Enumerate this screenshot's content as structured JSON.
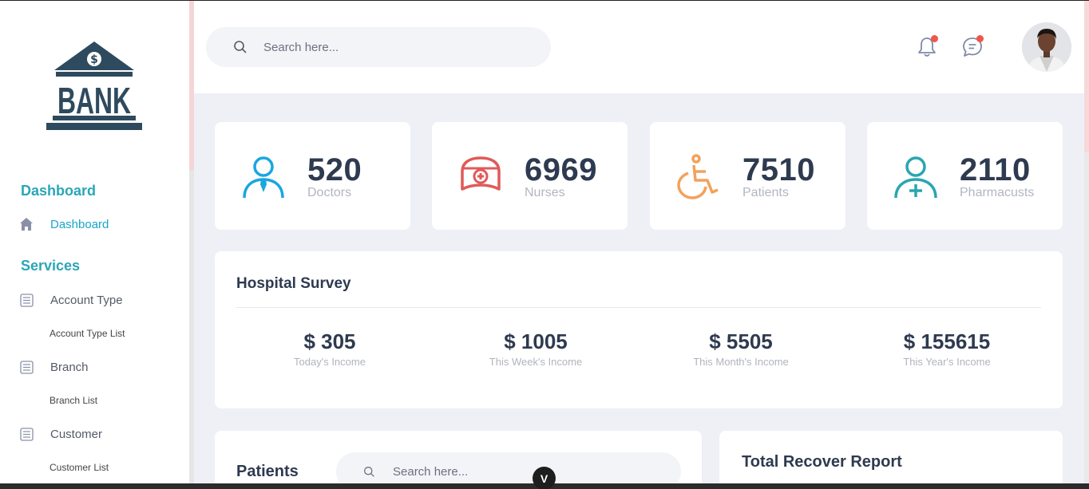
{
  "sidebar": {
    "logo_text": "BANK",
    "sections": [
      {
        "label": "Dashboard"
      },
      {
        "label": "Services"
      }
    ],
    "items": [
      {
        "label": "Dashboard",
        "icon": "home-icon"
      },
      {
        "label": "Account Type",
        "icon": "list-icon",
        "sub": "Account Type List"
      },
      {
        "label": "Branch",
        "icon": "list-icon",
        "sub": "Branch List"
      },
      {
        "label": "Customer",
        "icon": "list-icon",
        "sub": "Customer List"
      }
    ]
  },
  "header": {
    "search_placeholder": "Search here...",
    "notification_icon": "bell-icon",
    "message_icon": "chat-icon"
  },
  "stats": [
    {
      "value": "520",
      "label": "Doctors",
      "icon": "doctor-icon",
      "color": "#1aa6e0"
    },
    {
      "value": "6969",
      "label": "Nurses",
      "icon": "nurse-cap-icon",
      "color": "#e05a58"
    },
    {
      "value": "7510",
      "label": "Patients",
      "icon": "wheelchair-icon",
      "color": "#f3a15c"
    },
    {
      "value": "2110",
      "label": "Pharmacusts",
      "icon": "user-plus-icon",
      "color": "#2aa6b0"
    }
  ],
  "survey": {
    "title": "Hospital Survey",
    "incomes": [
      {
        "amount": "$ 305",
        "caption": "Today's Income"
      },
      {
        "amount": "$ 1005",
        "caption": "This Week's Income"
      },
      {
        "amount": "$ 5505",
        "caption": "This Month's Income"
      },
      {
        "amount": "$ 155615",
        "caption": "This Year's Income"
      }
    ]
  },
  "patients": {
    "title": "Patients",
    "search_placeholder": "Search here..."
  },
  "recover": {
    "title": "Total Recover Report"
  },
  "fab_label": "V",
  "colors": {
    "accent": "#2aa6b8",
    "heading": "#2e3a4f",
    "background": "#eef0f6",
    "notification_dot": "#f0564a"
  }
}
